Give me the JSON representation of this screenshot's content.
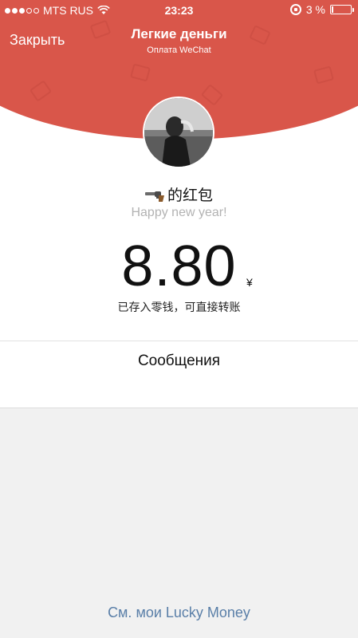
{
  "status_bar": {
    "carrier": "MTS RUS",
    "time": "23:23",
    "battery": "3 %",
    "battery_level": 0.03
  },
  "nav": {
    "close_label": "Закрыть",
    "title": "Легкие деньги",
    "subtitle": "Оплата WeChat"
  },
  "packet": {
    "sender": "的红包",
    "sender_icon": "revolver-emoji-icon",
    "greeting": "Happy new year!",
    "amount": "8.80",
    "currency": "¥",
    "note": "已存入零钱，可直接转账"
  },
  "messages": {
    "label": "Сообщения"
  },
  "footer": {
    "lucky_money_link": "См. мои Lucky Money"
  },
  "colors": {
    "header_red": "#d9564a",
    "link_blue": "#5a7fa8",
    "background": "#f1f1f1"
  }
}
